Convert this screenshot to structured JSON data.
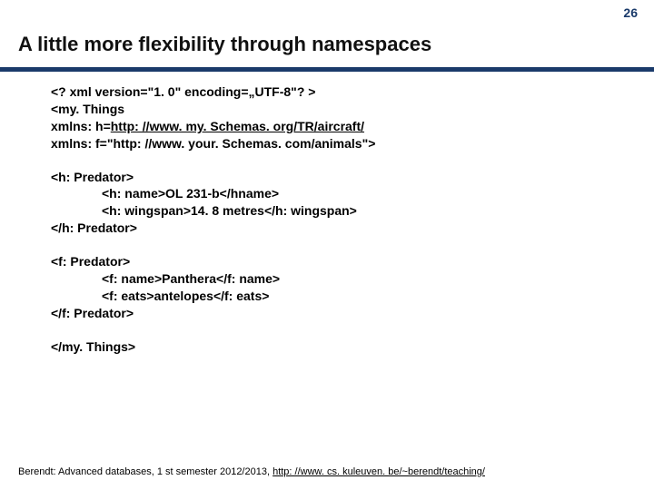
{
  "page_number": "26",
  "title": "A little more flexibility through namespaces",
  "xml": {
    "decl": "<? xml version=\"1. 0\" encoding=„UTF-8\"? >",
    "root_open": "<my. Things",
    "ns_h_prefix": "xmlns: h=",
    "ns_h_url": "http: //www. my. Schemas. org/TR/aircraft/",
    "ns_f": "xmlns: f=\"http: //www. your. Schemas. com/animals\">",
    "h_open": "<h: Predator>",
    "h_name": "<h: name>OL 231-b</hname>",
    "h_wing": "<h: wingspan>14. 8 metres</h: wingspan>",
    "h_close": "</h: Predator>",
    "f_open": "<f: Predator>",
    "f_name": "<f: name>Panthera</f: name>",
    "f_eats": "<f: eats>antelopes</f: eats>",
    "f_close": "</f: Predator>",
    "root_close": "</my. Things>"
  },
  "footer": {
    "text_prefix": "Berendt: Advanced databases, 1 st semester 2012/2013, ",
    "url": "http: //www. cs. kuleuven. be/~berendt/teaching/"
  }
}
